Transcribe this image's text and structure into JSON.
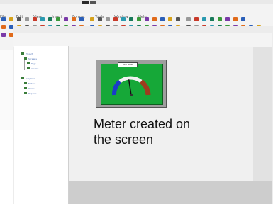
{
  "menu": {
    "items": [
      "File",
      "Edit",
      "View",
      "Insert",
      "Format",
      "Tools",
      "Window",
      "Help"
    ]
  },
  "tree": {
    "items": [
      "Project",
      "Screens",
      "Tags",
      "Alarms",
      "Graphics",
      "Meters",
      "Views",
      "Reports"
    ]
  },
  "meter": {
    "title": "Tank Meter",
    "needle_value": 0.45,
    "face_color": "#16a838"
  },
  "caption": {
    "line1": "Meter created on",
    "line2": "the screen"
  },
  "colors": {
    "canvas": "#f0f0f0",
    "meter_face": "#16a838",
    "frame": "#222222"
  }
}
